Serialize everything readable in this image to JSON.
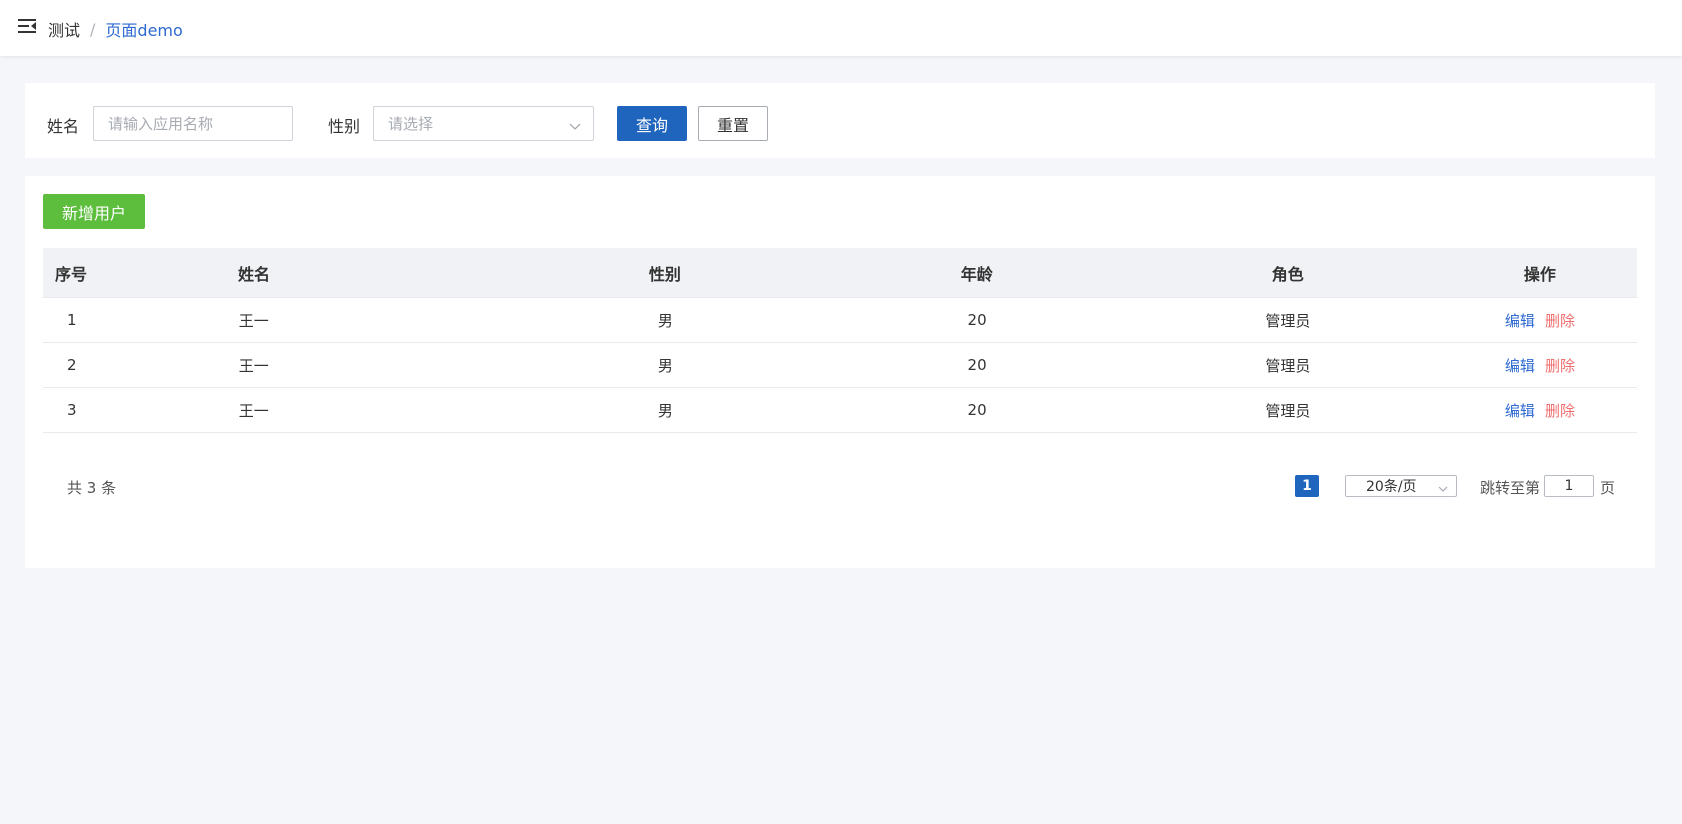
{
  "breadcrumb": {
    "items": [
      "测试"
    ],
    "separator": "/",
    "current": "页面demo"
  },
  "icons": {
    "menu_toggle": "menu-fold-icon",
    "select_arrow": "chevron-down-icon"
  },
  "search": {
    "name_label": "姓名",
    "name_placeholder": "请输入应用名称",
    "name_value": "",
    "gender_label": "性别",
    "gender_placeholder": "请选择",
    "query_label": "查询",
    "reset_label": "重置"
  },
  "toolbar": {
    "add_user_label": "新增用户"
  },
  "table": {
    "columns": [
      "序号",
      "姓名",
      "性别",
      "年龄",
      "角色",
      "操作"
    ],
    "rows": [
      {
        "idx": "1",
        "name": "王一",
        "gender": "男",
        "age": "20",
        "role": "管理员"
      },
      {
        "idx": "2",
        "name": "王一",
        "gender": "男",
        "age": "20",
        "role": "管理员"
      },
      {
        "idx": "3",
        "name": "王一",
        "gender": "男",
        "age": "20",
        "role": "管理员"
      }
    ],
    "edit_label": "编辑",
    "delete_label": "删除"
  },
  "pagination": {
    "total_text": "共 3 条",
    "current_page": "1",
    "page_size": "20条/页",
    "jump_prefix": "跳转至第",
    "jump_value": "1",
    "jump_suffix": "页"
  },
  "colors": {
    "primary": "#1f64bd",
    "success": "#5dbd3c",
    "danger": "#f06e6e",
    "link": "#2e6ad1",
    "background": "#f4f6f9"
  }
}
